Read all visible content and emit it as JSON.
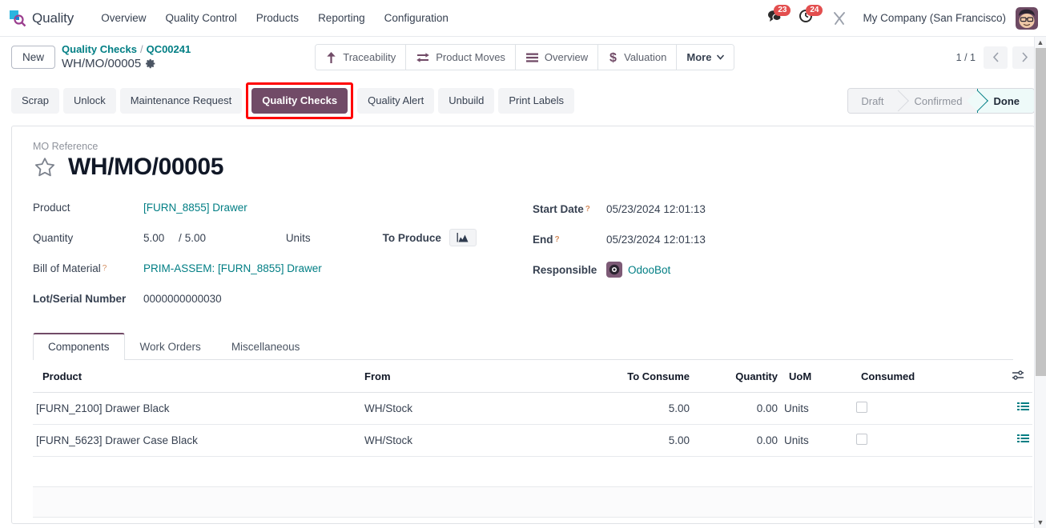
{
  "navbar": {
    "logo_icon": "quality-app-logo",
    "brand": "Quality",
    "menu": [
      {
        "label": "Overview"
      },
      {
        "label": "Quality Control"
      },
      {
        "label": "Products"
      },
      {
        "label": "Reporting"
      },
      {
        "label": "Configuration"
      }
    ],
    "messages_icon": "chat-bubble-icon",
    "messages_count": "23",
    "activities_icon": "clock-icon",
    "activities_count": "24",
    "tools_icon": "wrench-tools-icon",
    "company": "My Company (San Francisco)",
    "avatar_icon": "user-avatar"
  },
  "control_panel": {
    "new_label": "New",
    "breadcrumb": {
      "root": "Quality Checks",
      "separator": "/",
      "parent": "QC00241",
      "current": "WH/MO/00005",
      "settings_icon": "gear-icon"
    },
    "smart_buttons": [
      {
        "label": "Traceability",
        "icon": "arrow-up-icon"
      },
      {
        "label": "Product Moves",
        "icon": "exchange-arrows-icon"
      },
      {
        "label": "Overview",
        "icon": "list-bars-icon"
      },
      {
        "label": "Valuation",
        "icon": "dollar-icon"
      },
      {
        "label": "More",
        "icon": "chevron-down-icon"
      }
    ],
    "pager": {
      "value": "1 / 1",
      "prev_icon": "chevron-left-icon",
      "next_icon": "chevron-right-icon"
    }
  },
  "action_bar": {
    "buttons": [
      {
        "label": "Scrap",
        "highlighted": false
      },
      {
        "label": "Unlock",
        "highlighted": false
      },
      {
        "label": "Maintenance Request",
        "highlighted": false
      },
      {
        "label": "Quality Checks",
        "highlighted": true
      },
      {
        "label": "Quality Alert",
        "highlighted": false
      },
      {
        "label": "Unbuild",
        "highlighted": false
      },
      {
        "label": "Print Labels",
        "highlighted": false
      }
    ],
    "highlight_color": "#ff0000",
    "active_button_bg": "#714b67"
  },
  "status_pipeline": {
    "stages": [
      "Draft",
      "Confirmed",
      "Done"
    ],
    "active": "Done",
    "active_color": "#017e84"
  },
  "form": {
    "title_label": "MO Reference",
    "title": "WH/MO/00005",
    "star_icon": "star-outline-icon",
    "fields_left": {
      "product_label": "Product",
      "product_value": "[FURN_8855] Drawer",
      "quantity_label": "Quantity",
      "quantity_done": "5.00",
      "quantity_sep": "/",
      "quantity_total": "5.00",
      "quantity_uom": "Units",
      "to_produce_label": "To Produce",
      "to_produce_icon": "area-chart-icon",
      "bom_label": "Bill of Material",
      "bom_tip": "?",
      "bom_value": "PRIM-ASSEM: [FURN_8855] Drawer",
      "lot_label": "Lot/Serial Number",
      "lot_value": "0000000000030"
    },
    "fields_right": {
      "start_label": "Start Date",
      "start_tip": "?",
      "start_value": "05/23/2024 12:01:13",
      "end_label": "End",
      "end_tip": "?",
      "end_value": "05/23/2024 12:01:13",
      "responsible_label": "Responsible",
      "responsible_value": "OdooBot",
      "responsible_avatar_icon": "odoobot-avatar"
    }
  },
  "notebook": {
    "tabs": [
      {
        "label": "Components",
        "active": true
      },
      {
        "label": "Work Orders",
        "active": false
      },
      {
        "label": "Miscellaneous",
        "active": false
      }
    ],
    "table": {
      "headers": {
        "product": "Product",
        "from": "From",
        "to_consume": "To Consume",
        "quantity": "Quantity",
        "uom": "UoM",
        "consumed": "Consumed",
        "optional_icon": "column-options-icon"
      },
      "rows": [
        {
          "product": "[FURN_2100] Drawer Black",
          "from": "WH/Stock",
          "to_consume": "5.00",
          "quantity": "0.00",
          "uom": "Units",
          "consumed_checked": false,
          "detail_icon": "list-detail-icon"
        },
        {
          "product": "[FURN_5623] Drawer Case Black",
          "from": "WH/Stock",
          "to_consume": "5.00",
          "quantity": "0.00",
          "uom": "Units",
          "consumed_checked": false,
          "detail_icon": "list-detail-icon"
        }
      ]
    }
  },
  "scrollbar": {
    "up_icon": "scroll-up-arrow",
    "down_icon": "scroll-down-arrow"
  }
}
